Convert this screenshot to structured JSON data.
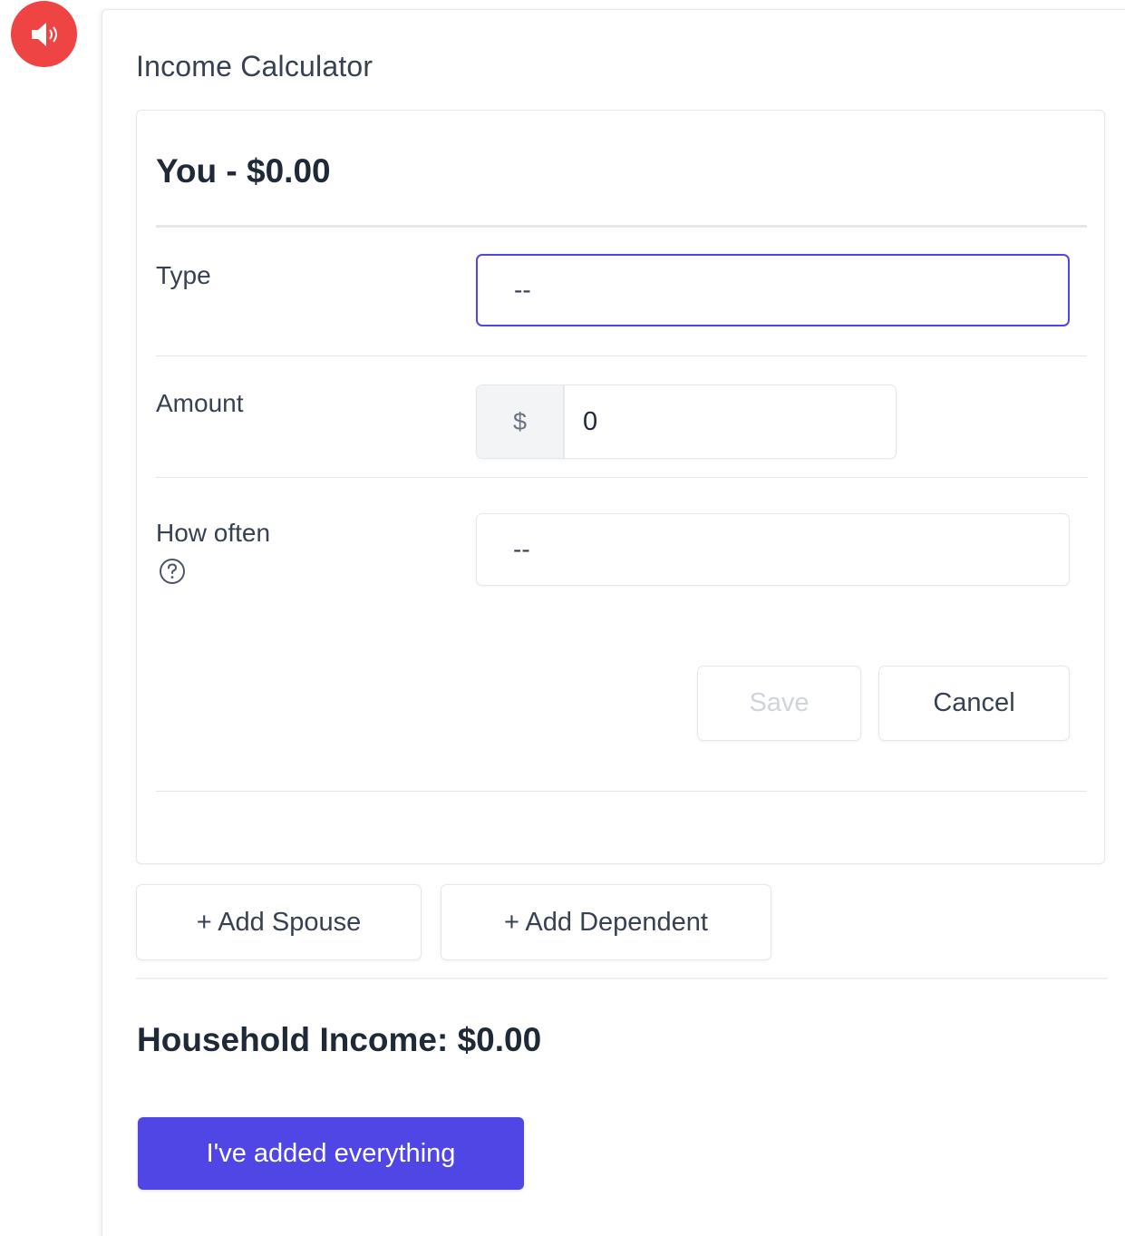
{
  "audio_button": {
    "icon": "speaker-icon",
    "color": "#ef4444"
  },
  "panel": {
    "title": "Income Calculator"
  },
  "card": {
    "header": "You - $0.00",
    "type_label": "Type",
    "type_value": "--",
    "amount_label": "Amount",
    "amount_prefix": "$",
    "amount_value": "0",
    "how_often_label": "How often",
    "how_often_value": "--",
    "save_label": "Save",
    "cancel_label": "Cancel"
  },
  "actions": {
    "add_spouse": "+ Add Spouse",
    "add_dependent": "+ Add Dependent"
  },
  "household_income": "Household Income: $0.00",
  "primary_button": "I've added everything",
  "colors": {
    "accent": "#4f46e5",
    "focus_border": "#5046e5",
    "audio": "#ef4444"
  }
}
